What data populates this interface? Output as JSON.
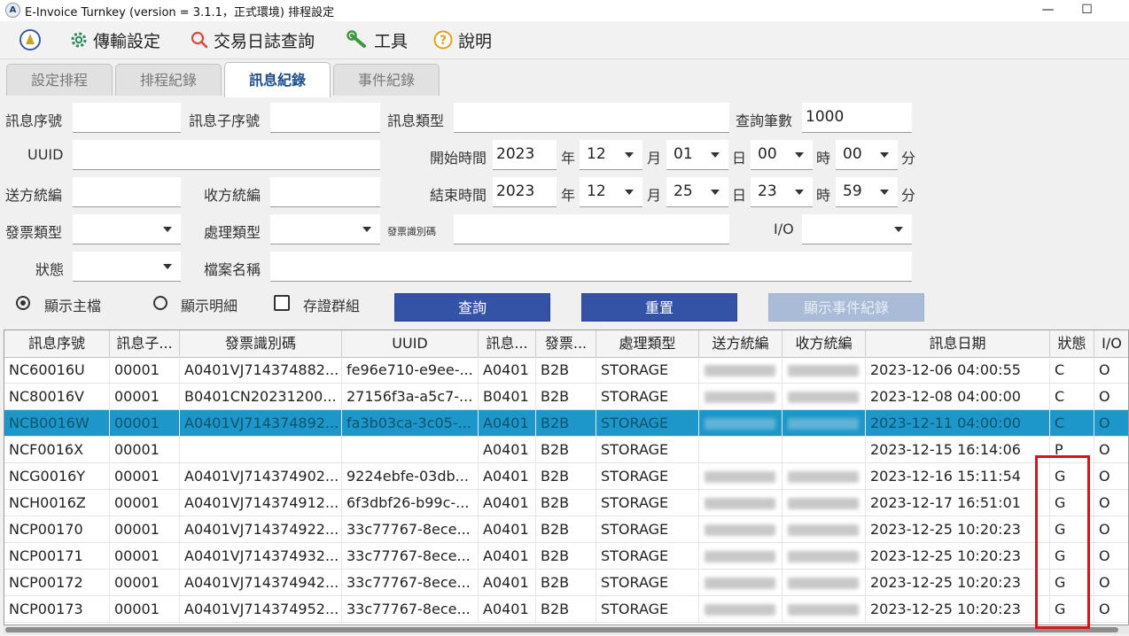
{
  "window": {
    "title": "E-Invoice Turnkey (version = 3.1.1，正式環境) 排程設定",
    "minimize_glyph": "—",
    "maximize_glyph": "☐"
  },
  "menu": {
    "items": [
      "傳輸設定",
      "交易日誌查詢",
      "工具",
      "說明"
    ],
    "icons": [
      "gear-icon",
      "search-icon",
      "wrench-icon",
      "help-icon"
    ]
  },
  "tabs": [
    "設定排程",
    "排程紀錄",
    "訊息紀錄",
    "事件紀錄"
  ],
  "active_tab": "訊息紀錄",
  "form": {
    "msg_seq_label": "訊息序號",
    "msg_subseq_label": "訊息子序號",
    "msg_type_label": "訊息類型",
    "query_count_label": "查詢筆數",
    "query_count_value": "1000",
    "uuid_label": "UUID",
    "start_time_label": "開始時間",
    "end_time_label": "結束時間",
    "sender_label": "送方統編",
    "receiver_label": "收方統編",
    "invoice_type_label": "發票類型",
    "process_type_label": "處理類型",
    "invoice_id_label": "發票識別碼",
    "io_label": "I/O",
    "status_label": "狀態",
    "filename_label": "檔案名稱",
    "year_unit": "年",
    "month_unit": "月",
    "day_unit": "日",
    "hour_unit": "時",
    "minute_unit": "分",
    "start": {
      "year": "2023",
      "month": "12",
      "day": "01",
      "hour": "00",
      "minute": "00"
    },
    "end": {
      "year": "2023",
      "month": "12",
      "day": "25",
      "hour": "23",
      "minute": "59"
    }
  },
  "options": {
    "show_master_label": "顯示主檔",
    "show_detail_label": "顯示明細",
    "evidence_group_label": "存證群組",
    "show_master_selected": true
  },
  "buttons": {
    "query": "查詢",
    "reset": "重置",
    "show_events": "顯示事件紀錄"
  },
  "table": {
    "columns": [
      "訊息序號",
      "訊息子...",
      "發票識別碼",
      "UUID",
      "訊息...",
      "發票...",
      "處理類型",
      "送方統編",
      "收方統編",
      "訊息日期",
      "狀態",
      "I/O"
    ],
    "selected_row": 2,
    "rows": [
      [
        "NC60016U",
        "00001",
        "A0401VJ714374882...",
        "fe96e710-e9ee-...",
        "A0401",
        "B2B",
        "STORAGE",
        "",
        "",
        "2023-12-06 04:00:55",
        "C",
        "O"
      ],
      [
        "NC80016V",
        "00001",
        "B0401CN20231200...",
        "27156f3a-a5c7-...",
        "B0401",
        "B2B",
        "STORAGE",
        "",
        "",
        "2023-12-08 04:00:00",
        "C",
        "O"
      ],
      [
        "NCB0016W",
        "00001",
        "A0401VJ714374892...",
        "fa3b03ca-3c05-...",
        "A0401",
        "B2B",
        "STORAGE",
        "",
        "",
        "2023-12-11 04:00:00",
        "C",
        "O"
      ],
      [
        "NCF0016X",
        "00001",
        "",
        "",
        "A0401",
        "B2B",
        "STORAGE",
        "",
        "",
        "2023-12-15 16:14:06",
        "P",
        "O"
      ],
      [
        "NCG0016Y",
        "00001",
        "A0401VJ714374902...",
        "9224ebfe-03db...",
        "A0401",
        "B2B",
        "STORAGE",
        "",
        "",
        "2023-12-16 15:11:54",
        "G",
        "O"
      ],
      [
        "NCH0016Z",
        "00001",
        "A0401VJ714374912...",
        "6f3dbf26-b99c-...",
        "A0401",
        "B2B",
        "STORAGE",
        "",
        "",
        "2023-12-17 16:51:01",
        "G",
        "O"
      ],
      [
        "NCP00170",
        "00001",
        "A0401VJ714374922...",
        "33c77767-8ece...",
        "A0401",
        "B2B",
        "STORAGE",
        "",
        "",
        "2023-12-25 10:20:23",
        "G",
        "O"
      ],
      [
        "NCP00171",
        "00001",
        "A0401VJ714374932...",
        "33c77767-8ece...",
        "A0401",
        "B2B",
        "STORAGE",
        "",
        "",
        "2023-12-25 10:20:23",
        "G",
        "O"
      ],
      [
        "NCP00172",
        "00001",
        "A0401VJ714374942...",
        "33c77767-8ece...",
        "A0401",
        "B2B",
        "STORAGE",
        "",
        "",
        "2023-12-25 10:20:23",
        "G",
        "O"
      ],
      [
        "NCP00173",
        "00001",
        "A0401VJ714374952...",
        "33c77767-8ece...",
        "A0401",
        "B2B",
        "STORAGE",
        "",
        "",
        "2023-12-25 10:20:23",
        "G",
        "O"
      ]
    ]
  },
  "colors": {
    "selected_row": "#1d97c9",
    "button": "#3452a6",
    "highlight_box": "#d4161c"
  }
}
